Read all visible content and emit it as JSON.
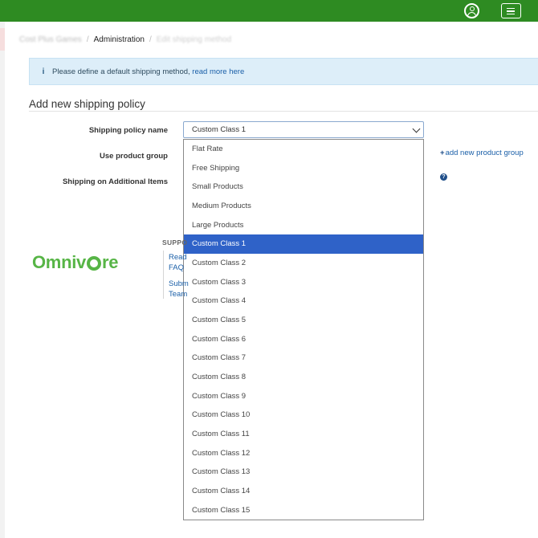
{
  "header": {
    "user_icon": "user-circle-icon",
    "menu_icon": "hamburger-menu-icon",
    "brand_color": "#2e8b22"
  },
  "breadcrumb": {
    "items": [
      "Cost Plus Games",
      "Administration",
      "Edit shipping method"
    ],
    "separator": "/"
  },
  "alert": {
    "text": "Please define a default shipping method,",
    "link": "read more here",
    "icon": "info-icon"
  },
  "section": {
    "title": "Add new shipping policy"
  },
  "form": {
    "policy_name_label": "Shipping policy name",
    "use_group_label": "Use product group",
    "additional_label": "Shipping on Additional Items",
    "selected_value": "Custom Class 1",
    "options": [
      "Flat Rate",
      "Free Shipping",
      "Small Products",
      "Medium Products",
      "Large Products",
      "Custom Class 1",
      "Custom Class 2",
      "Custom Class 3",
      "Custom Class 4",
      "Custom Class 5",
      "Custom Class 6",
      "Custom Class 7",
      "Custom Class 8",
      "Custom Class 9",
      "Custom Class 10",
      "Custom Class 11",
      "Custom Class 12",
      "Custom Class 13",
      "Custom Class 14",
      "Custom Class 15"
    ],
    "selected_index": 5,
    "add_group_link": "add new product group",
    "help_icon": "question-circle-icon"
  },
  "footer": {
    "logo_text_left": "Omniv",
    "logo_text_right": "re",
    "support_title": "SUPPO",
    "links": [
      "Read",
      "FAQ",
      "Subm",
      "Team"
    ]
  }
}
